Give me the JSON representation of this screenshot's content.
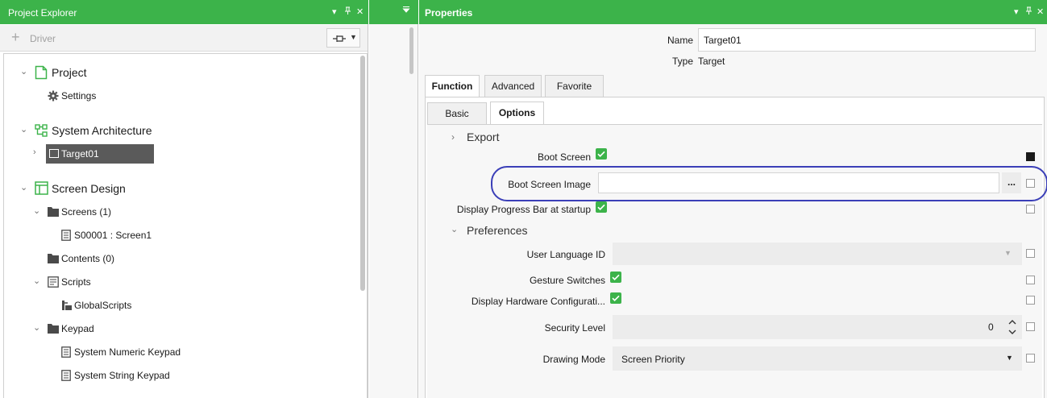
{
  "project_explorer": {
    "title": "Project Explorer",
    "toolbar": {
      "driver_label": "Driver",
      "pin_glyph": "⊣⊢"
    },
    "tree": {
      "project": "Project",
      "settings": "Settings",
      "system_architecture": "System Architecture",
      "target": "Target01",
      "screen_design": "Screen Design",
      "screens": "Screens (1)",
      "screen1": "S00001 : Screen1",
      "contents": "Contents (0)",
      "scripts": "Scripts",
      "global_scripts": "GlobalScripts",
      "keypad": "Keypad",
      "numeric_keypad": "System Numeric Keypad",
      "string_keypad": "System String Keypad"
    }
  },
  "properties": {
    "title": "Properties",
    "name_label": "Name",
    "name_value": "Target01",
    "type_label": "Type",
    "type_value": "Target",
    "tabs": [
      "Function",
      "Advanced",
      "Favorite"
    ],
    "subtabs": [
      "Basic",
      "Options"
    ],
    "export_section": "Export",
    "boot_screen_label": "Boot Screen",
    "boot_screen_image_label": "Boot Screen Image",
    "boot_screen_image_value": "",
    "browse_label": "...",
    "display_progress_label": "Display Progress Bar at startup",
    "preferences_section": "Preferences",
    "user_language_label": "User Language ID",
    "user_language_value": "",
    "gesture_label": "Gesture Switches",
    "display_hw_label": "Display Hardware Configurati...",
    "security_label": "Security Level",
    "security_value": "0",
    "drawing_mode_label": "Drawing Mode",
    "drawing_mode_value": "Screen Priority"
  },
  "colors": {
    "accent": "#3cb34a",
    "selection": "#5a5a5a",
    "highlight_ring": "#3b3fb8"
  }
}
